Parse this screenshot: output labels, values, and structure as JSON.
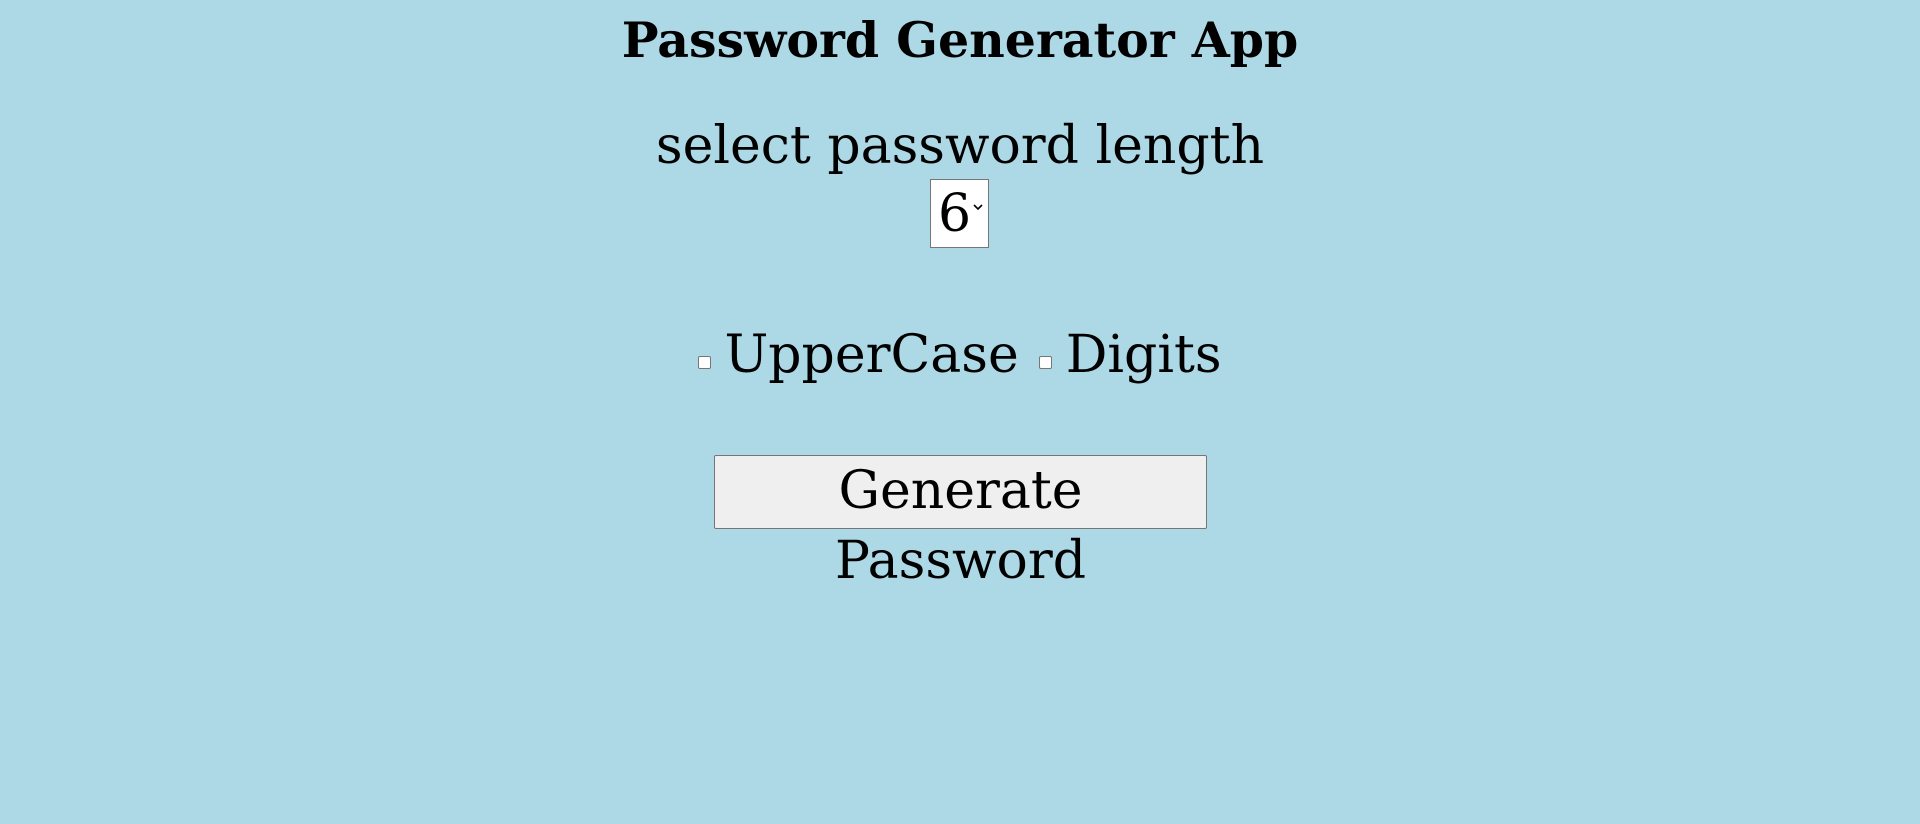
{
  "app": {
    "title": "Password Generator App"
  },
  "length": {
    "label": "select password length",
    "selected_value": "6"
  },
  "options": {
    "uppercase_label": "UpperCase",
    "digits_label": "Digits"
  },
  "actions": {
    "generate_label": "Generate Password"
  },
  "colors": {
    "background": "#add8e6",
    "button_background": "#efefef",
    "input_background": "#ffffff"
  }
}
